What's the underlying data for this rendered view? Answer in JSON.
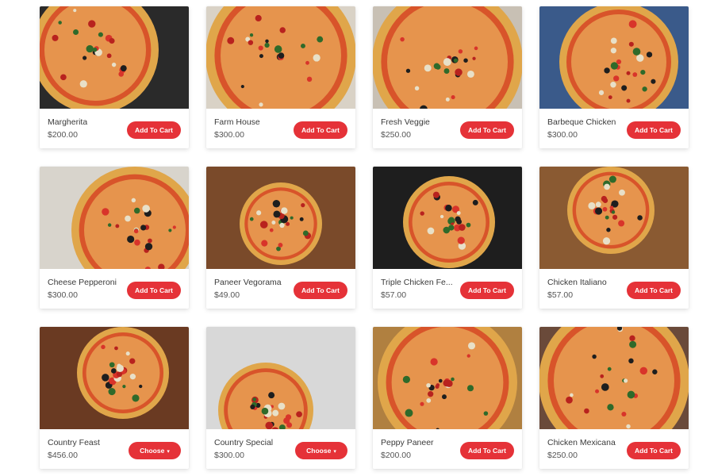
{
  "products": [
    {
      "name": "Margherita",
      "price": "$200.00",
      "button": "Add To Cart",
      "button_type": "add",
      "image": "margherita-pizza-on-grill",
      "bg": "#2a2a2a"
    },
    {
      "name": "Farm House",
      "price": "$300.00",
      "button": "Add To Cart",
      "button_type": "add",
      "image": "farm-house-pizza",
      "bg": "#d9d2c6"
    },
    {
      "name": "Fresh Veggie",
      "price": "$250.00",
      "button": "Add To Cart",
      "button_type": "add",
      "image": "fresh-veggie-pizza-olives",
      "bg": "#c8c0b4"
    },
    {
      "name": "Barbeque Chicken",
      "price": "$300.00",
      "button": "Add To Cart",
      "button_type": "add",
      "image": "barbeque-chicken-pizza",
      "bg": "#3a5a8a"
    },
    {
      "name": "Cheese Pepperoni",
      "price": "$300.00",
      "button": "Add To Cart",
      "button_type": "add",
      "image": "cheese-pepperoni-pizza-greens",
      "bg": "#d8d4cc"
    },
    {
      "name": "Paneer Vegorama",
      "price": "$49.00",
      "button": "Add To Cart",
      "button_type": "add",
      "image": "paneer-vegorama-pizza",
      "bg": "#7a4a2a"
    },
    {
      "name": "Triple Chicken Fe...",
      "price": "$57.00",
      "button": "Add To Cart",
      "button_type": "add",
      "image": "triple-chicken-feast-pizza",
      "bg": "#1e1e1e"
    },
    {
      "name": "Chicken Italiano",
      "price": "$57.00",
      "button": "Add To Cart",
      "button_type": "add",
      "image": "chicken-italiano-pizza",
      "bg": "#8a5a32"
    },
    {
      "name": "Country Feast",
      "price": "$456.00",
      "button": "Choose",
      "button_type": "choose",
      "image": "country-feast-pizza",
      "bg": "#6a3a22"
    },
    {
      "name": "Country Special",
      "price": "$300.00",
      "button": "Choose",
      "button_type": "choose",
      "image": "country-special-pizza-wine",
      "bg": "#d8d8d8"
    },
    {
      "name": "Peppy Paneer",
      "price": "$200.00",
      "button": "Add To Cart",
      "button_type": "add",
      "image": "peppy-paneer-pizza",
      "bg": "#b08040"
    },
    {
      "name": "Chicken Mexicana",
      "price": "$250.00",
      "button": "Add To Cart",
      "button_type": "add",
      "image": "chicken-mexicana-pizza",
      "bg": "#6a4a3a"
    }
  ],
  "colors": {
    "button": "#e53238",
    "crust": "#e0a64a",
    "sauce": "#d8542a",
    "cheese": "#f2c86a"
  }
}
